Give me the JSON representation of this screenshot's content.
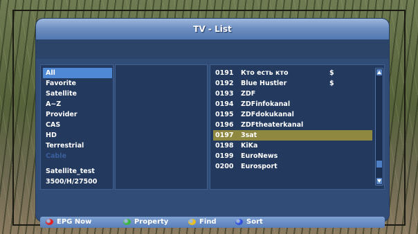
{
  "window": {
    "title": "TV - List"
  },
  "groups": [
    {
      "label": "All",
      "selected": true,
      "disabled": false
    },
    {
      "label": "Favorite",
      "selected": false,
      "disabled": false
    },
    {
      "label": "Satellite",
      "selected": false,
      "disabled": false
    },
    {
      "label": "A~Z",
      "selected": false,
      "disabled": false
    },
    {
      "label": "Provider",
      "selected": false,
      "disabled": false
    },
    {
      "label": "CAS",
      "selected": false,
      "disabled": false
    },
    {
      "label": "HD",
      "selected": false,
      "disabled": false
    },
    {
      "label": "Terrestrial",
      "selected": false,
      "disabled": false
    },
    {
      "label": "Cable",
      "selected": false,
      "disabled": true
    }
  ],
  "satellite": {
    "name": "Satellite_test",
    "params": "3500/H/27500"
  },
  "channels": [
    {
      "num": "0191",
      "name": "Кто есть кто",
      "flag": "$"
    },
    {
      "num": "0192",
      "name": "Blue Hustler",
      "flag": "$"
    },
    {
      "num": "0193",
      "name": "ZDF",
      "flag": ""
    },
    {
      "num": "0194",
      "name": "ZDFinfokanal",
      "flag": ""
    },
    {
      "num": "0195",
      "name": "ZDFdokukanal",
      "flag": ""
    },
    {
      "num": "0196",
      "name": "ZDFtheaterkanal",
      "flag": ""
    },
    {
      "num": "0197",
      "name": "3sat",
      "flag": "",
      "selected": true
    },
    {
      "num": "0198",
      "name": "KiKa",
      "flag": ""
    },
    {
      "num": "0199",
      "name": "EuroNews",
      "flag": ""
    },
    {
      "num": "0200",
      "name": "Eurosport",
      "flag": ""
    }
  ],
  "scroll_position": 0.9,
  "footer_hints": [
    {
      "label": "EPG Now",
      "color": "#e02020",
      "icon": "red-button-icon"
    },
    {
      "label": "Property",
      "color": "#3cb840",
      "icon": "green-button-icon"
    },
    {
      "label": "Find",
      "color": "#e8c020",
      "icon": "yellow-button-icon"
    },
    {
      "label": "Sort",
      "color": "#3050e0",
      "icon": "blue-button-icon"
    }
  ],
  "colors": {
    "dialog_bg": "#314c76",
    "selection_group": "#4f88d4",
    "selection_channel": "#8f8840"
  }
}
